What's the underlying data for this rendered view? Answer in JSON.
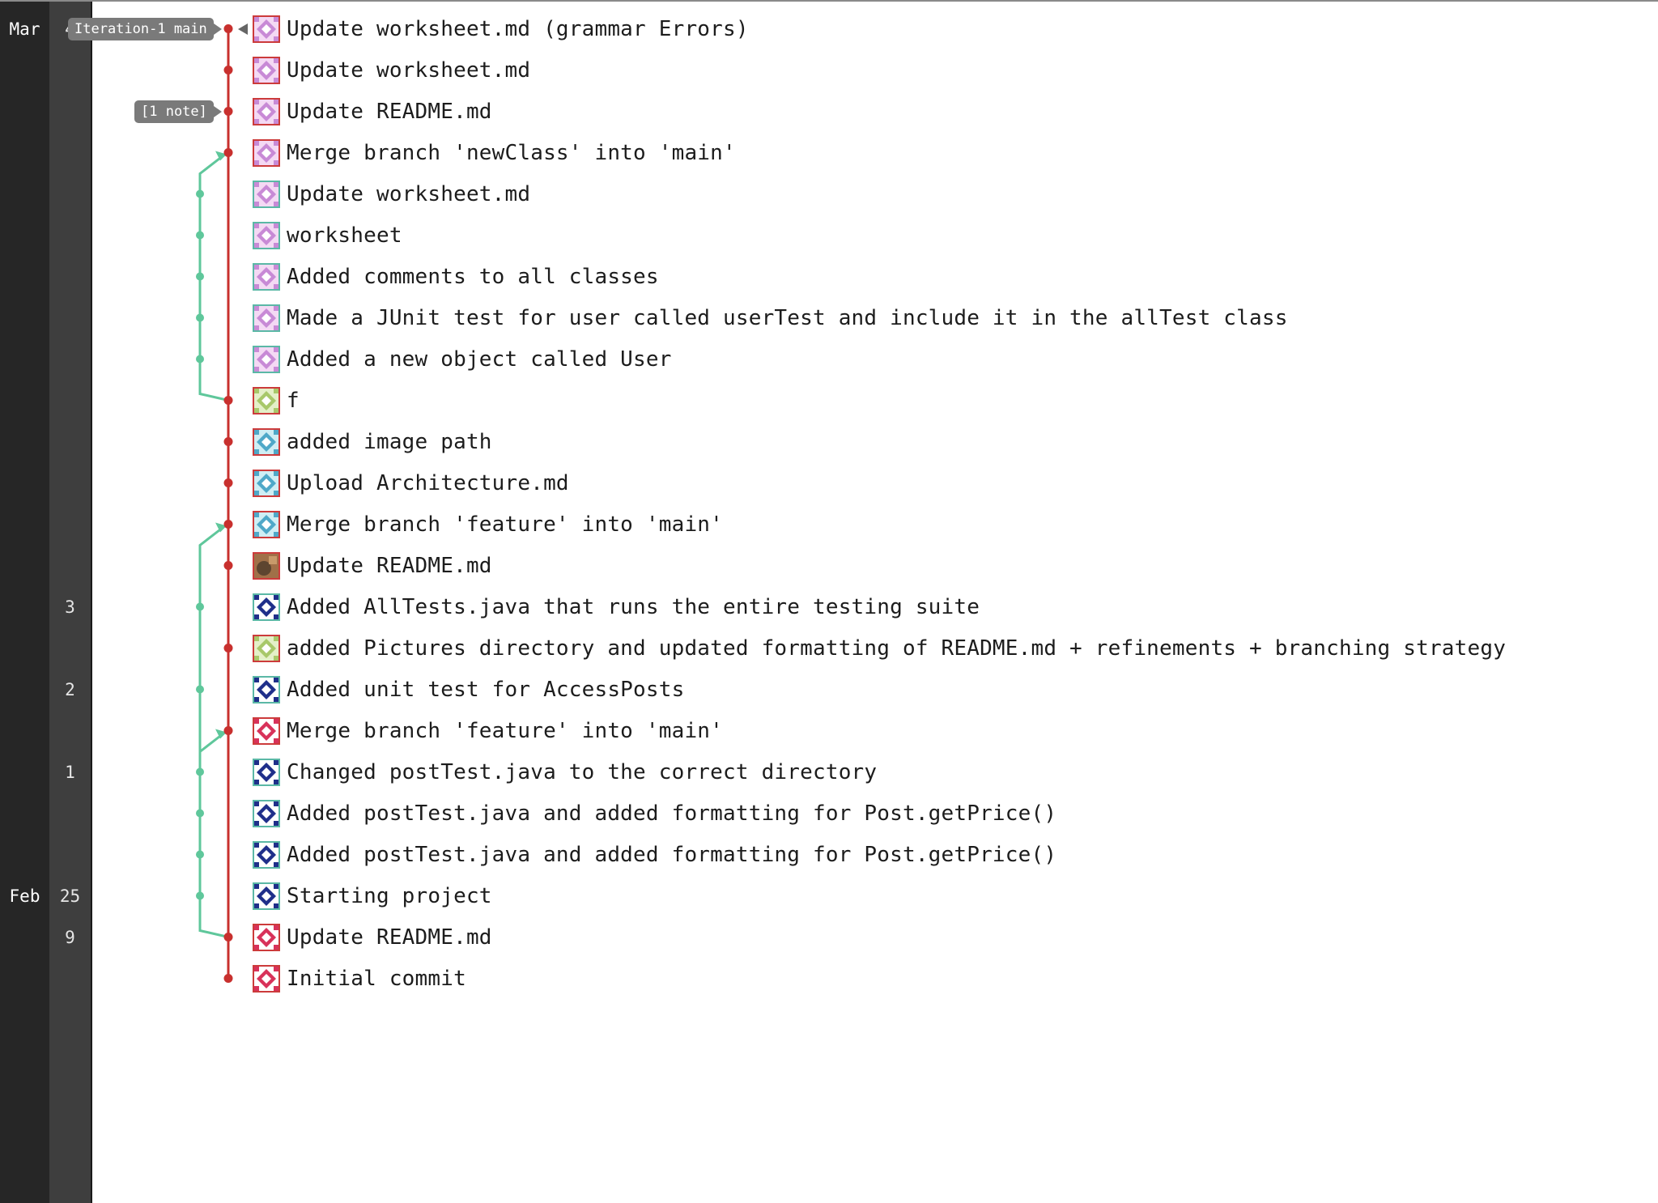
{
  "timeline": {
    "months": [
      {
        "label": "Mar",
        "row": 0
      },
      {
        "label": "Feb",
        "row": 21
      }
    ],
    "days": [
      {
        "label": "4",
        "row": 0
      },
      {
        "label": "3",
        "row": 14
      },
      {
        "label": "2",
        "row": 16
      },
      {
        "label": "1",
        "row": 18
      },
      {
        "label": "25",
        "row": 21
      },
      {
        "label": "9",
        "row": 22
      }
    ]
  },
  "refs": {
    "branch_tag": "Iteration-1 main",
    "note_tag": "[1 note]"
  },
  "colors": {
    "main_branch": "#c8302e",
    "side_branch": "#5fc79b"
  },
  "commits": [
    {
      "message": "Update worksheet.md (grammar Errors)",
      "avatar": "pink-quilt",
      "border": "red"
    },
    {
      "message": "Update worksheet.md",
      "avatar": "pink-quilt",
      "border": "red"
    },
    {
      "message": "Update README.md",
      "avatar": "pink-quilt",
      "border": "red"
    },
    {
      "message": "Merge branch 'newClass' into 'main'",
      "avatar": "pink-quilt",
      "border": "red"
    },
    {
      "message": "Update worksheet.md",
      "avatar": "pink-quilt",
      "border": "teal"
    },
    {
      "message": "worksheet",
      "avatar": "pink-quilt",
      "border": "teal"
    },
    {
      "message": "Added comments to all classes",
      "avatar": "pink-quilt",
      "border": "teal"
    },
    {
      "message": "Made a JUnit test for user called userTest and include it in the allTest class",
      "avatar": "pink-quilt",
      "border": "teal"
    },
    {
      "message": "Added a new object called User",
      "avatar": "pink-quilt",
      "border": "teal"
    },
    {
      "message": "f",
      "avatar": "green-quilt",
      "border": "red"
    },
    {
      "message": "added image path",
      "avatar": "cyan-quilt",
      "border": "red"
    },
    {
      "message": "Upload Architecture.md",
      "avatar": "cyan-quilt",
      "border": "red"
    },
    {
      "message": "Merge branch 'feature' into 'main'",
      "avatar": "cyan-quilt",
      "border": "red"
    },
    {
      "message": "Update README.md",
      "avatar": "photo",
      "border": "red"
    },
    {
      "message": "Added AllTests.java that runs the entire testing suite",
      "avatar": "navy-quilt",
      "border": "teal"
    },
    {
      "message": "added Pictures directory and updated formatting of README.md + refinements + branching strategy",
      "avatar": "green-quilt",
      "border": "red"
    },
    {
      "message": "Added unit test for AccessPosts",
      "avatar": "navy-quilt",
      "border": "teal"
    },
    {
      "message": "Merge branch 'feature' into 'main'",
      "avatar": "red-quilt",
      "border": "red"
    },
    {
      "message": "Changed postTest.java to the correct directory",
      "avatar": "navy-quilt",
      "border": "teal"
    },
    {
      "message": "Added postTest.java and added formatting for Post.getPrice()",
      "avatar": "navy-quilt",
      "border": "teal"
    },
    {
      "message": "Added postTest.java and added formatting for Post.getPrice()",
      "avatar": "navy-quilt",
      "border": "teal"
    },
    {
      "message": "Starting project",
      "avatar": "navy-quilt",
      "border": "teal"
    },
    {
      "message": "Update README.md",
      "avatar": "red-quilt",
      "border": "red"
    },
    {
      "message": "Initial commit",
      "avatar": "red-quilt",
      "border": "red"
    }
  ]
}
